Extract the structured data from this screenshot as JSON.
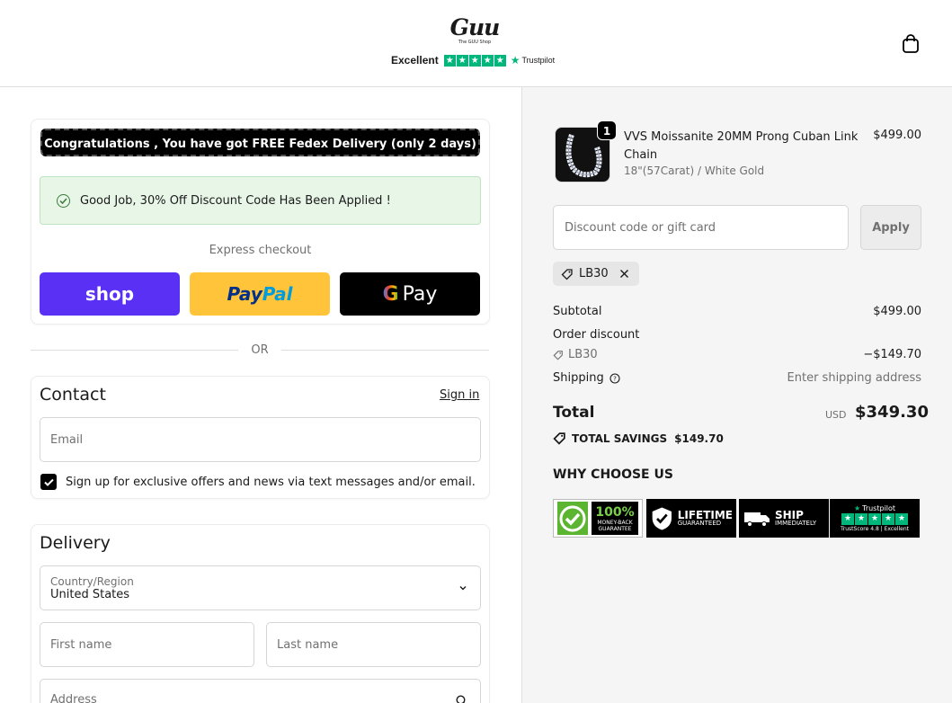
{
  "header": {
    "logo_text": "Guu",
    "logo_sub": "The GUU Shop",
    "trust_label": "Excellent",
    "trust_brand": "Trustpilot"
  },
  "express": {
    "banner": "Congratulations , You have got FREE Fedex Delivery (only 2 days)",
    "discount_message": "Good Job, 30% Off Discount Code Has Been Applied !",
    "label": "Express checkout",
    "shop_pay": "shop",
    "paypal_1": "Pay",
    "paypal_2": "Pal",
    "gpay_g": "G",
    "gpay_text": "Pay"
  },
  "divider": {
    "or": "OR"
  },
  "contact": {
    "title": "Contact",
    "signin": "Sign in",
    "email_placeholder": "Email",
    "signup_text": "Sign up for exclusive offers and news via text messages and/or email."
  },
  "delivery": {
    "title": "Delivery",
    "country_label": "Country/Region",
    "country_value": "United States",
    "first_name": "First name",
    "last_name": "Last name",
    "address": "Address"
  },
  "order": {
    "quantity": "1",
    "product_name": "VVS Moissanite 20MM Prong Cuban Link Chain",
    "variant": "18\"(57Carat) / White Gold",
    "price": "$499.00",
    "discount_placeholder": "Discount code or gift card",
    "apply": "Apply",
    "code": "LB30",
    "subtotal_label": "Subtotal",
    "subtotal_value": "$499.00",
    "order_discount_label": "Order discount",
    "discount_code": "LB30",
    "discount_value": "−$149.70",
    "shipping_label": "Shipping",
    "shipping_value": "Enter shipping address",
    "total_label": "Total",
    "currency": "USD",
    "total_value": "$349.30",
    "savings_label": "TOTAL SAVINGS",
    "savings_value": "$149.70",
    "why_title": "WHY CHOOSE US"
  },
  "badges": {
    "b1_main": "100%",
    "b1_sub": "MONEY-BACK GUARANTEE",
    "b2_main": "LIFETIME",
    "b2_sub": "GUARANTEED",
    "b3_main": "SHIP",
    "b3_sub": "IMMEDIATELY",
    "b4_main": "Trustpilot",
    "b4_sub": "TrustScore 4.8 | Excellent"
  },
  "colors": {
    "shop_pay": "#5a31f4",
    "paypal": "#ffc439",
    "trustpilot_green": "#00b67a",
    "right_panel_bg": "#f5f5f5"
  }
}
